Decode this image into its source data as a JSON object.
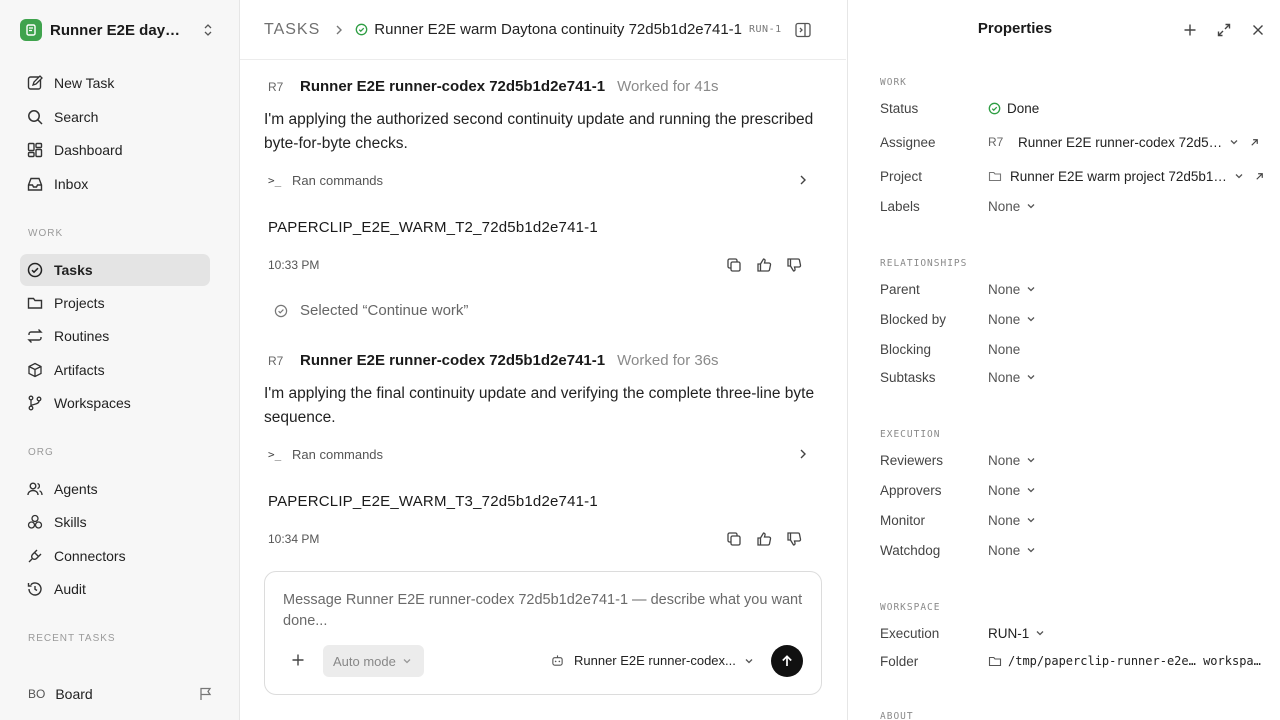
{
  "workspace": {
    "name": "Runner E2E dayt..."
  },
  "nav": {
    "new_task": "New Task",
    "search": "Search",
    "dashboard": "Dashboard",
    "inbox": "Inbox",
    "work_section": "WORK",
    "tasks": "Tasks",
    "projects": "Projects",
    "routines": "Routines",
    "artifacts": "Artifacts",
    "workspaces": "Workspaces",
    "org_section": "ORG",
    "agents": "Agents",
    "skills": "Skills",
    "connectors": "Connectors",
    "audit": "Audit",
    "recent_section": "RECENT TASKS",
    "board_initials": "BO",
    "board": "Board"
  },
  "header": {
    "root": "TASKS",
    "title": "Runner E2E warm Daytona continuity 72d5b1d2e741-1",
    "run_id": "RUN-1"
  },
  "messages": [
    {
      "initials": "R7",
      "author": "Runner E2E runner-codex 72d5b1d2e741-1",
      "worked": "Worked for 41s",
      "text": "I'm applying the authorized second continuity update and running the prescribed byte-for-byte checks.",
      "ran": "Ran commands",
      "output": "PAPERCLIP_E2E_WARM_T2_72d5b1d2e741-1",
      "time": "10:33 PM"
    },
    {
      "initials": "R7",
      "author": "Runner E2E runner-codex 72d5b1d2e741-1",
      "worked": "Worked for 36s",
      "text": "I'm applying the final continuity update and verifying the complete three-line byte sequence.",
      "ran": "Ran commands",
      "output": "PAPERCLIP_E2E_WARM_T3_72d5b1d2e741-1",
      "time": "10:34 PM"
    }
  ],
  "selected_event": "Selected “Continue work”",
  "composer": {
    "placeholder": "Message Runner E2E runner-codex 72d5b1d2e741-1 — describe what you want done...",
    "mode": "Auto mode",
    "agent": "Runner E2E runner-codex..."
  },
  "properties": {
    "title": "Properties",
    "work_section": "WORK",
    "status_label": "Status",
    "status_value": "Done",
    "assignee_label": "Assignee",
    "assignee_initials": "R7",
    "assignee_value": "Runner E2E runner-codex 72d5b1...",
    "project_label": "Project",
    "project_value": "Runner E2E warm project 72d5b1d2...",
    "labels_label": "Labels",
    "none": "None",
    "relationships_section": "RELATIONSHIPS",
    "parent_label": "Parent",
    "blocked_by_label": "Blocked by",
    "blocking_label": "Blocking",
    "subtasks_label": "Subtasks",
    "execution_section": "EXECUTION",
    "reviewers_label": "Reviewers",
    "approvers_label": "Approvers",
    "monitor_label": "Monitor",
    "watchdog_label": "Watchdog",
    "workspace_section": "WORKSPACE",
    "execution_label": "Execution",
    "execution_value": "RUN-1",
    "folder_label": "Folder",
    "folder_value": "/tmp/paperclip-runner-e2e… workspace",
    "about_section": "ABOUT"
  },
  "colors": {
    "accent_green": "#3fa34d",
    "send_button": "#111111",
    "active_nav": "#e4e4e4"
  }
}
